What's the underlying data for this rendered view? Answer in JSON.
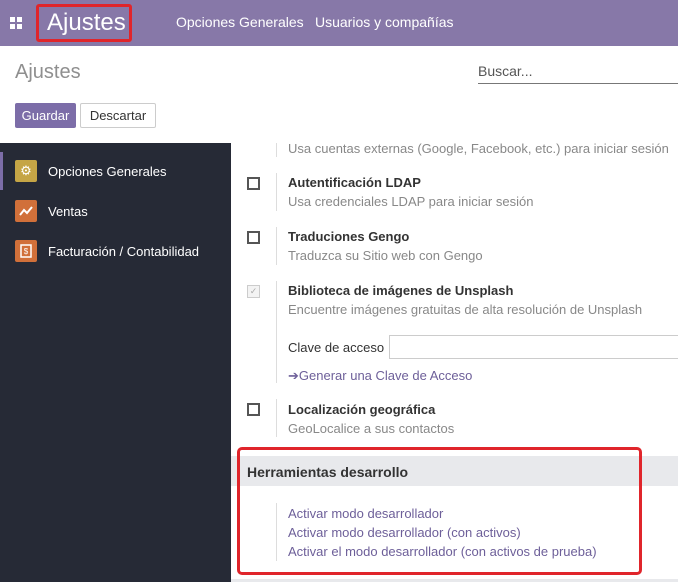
{
  "topbar": {
    "app_title": "Ajustes",
    "nav": [
      "Opciones Generales",
      "Usuarios y compañías"
    ]
  },
  "control_panel": {
    "title": "Ajustes",
    "search_placeholder": "Buscar...",
    "save_label": "Guardar",
    "discard_label": "Descartar"
  },
  "sidebar": {
    "items": [
      {
        "label": "Opciones Generales",
        "icon": "gear-icon",
        "color": "#c5a546"
      },
      {
        "label": "Ventas",
        "icon": "chart-icon",
        "color": "#d1703a"
      },
      {
        "label": "Facturación / Contabilidad",
        "icon": "invoice-icon",
        "color": "#d1703a"
      }
    ]
  },
  "settings": {
    "cut_desc": "Usa cuentas externas (Google, Facebook, etc.) para iniciar sesión",
    "ldap": {
      "title": "Autentificación LDAP",
      "desc": "Usa credenciales LDAP para iniciar sesión",
      "checked": false
    },
    "gengo": {
      "title": "Traduciones Gengo",
      "desc": "Traduzca su Sitio web con Gengo",
      "checked": false
    },
    "unsplash": {
      "title": "Biblioteca de imágenes de Unsplash",
      "desc": "Encuentre imágenes gratuitas de alta resolución de Unsplash",
      "checked": true,
      "access_key_label": "Clave de acceso",
      "generate_link": "Generar una Clave de Acceso"
    },
    "geo": {
      "title": "Localización geográfica",
      "desc": "GeoLocalice a sus contactos",
      "checked": false
    }
  },
  "dev_tools": {
    "title": "Herramientas desarrollo",
    "links": [
      "Activar modo desarrollador",
      "Activar modo desarrollador (con activos)",
      "Activar el modo desarrollador (con activos de prueba)"
    ]
  },
  "colors": {
    "topbar": "#8778a8",
    "primary": "#7c6da8",
    "sidebar": "#262a36",
    "highlight": "#e0252b"
  }
}
